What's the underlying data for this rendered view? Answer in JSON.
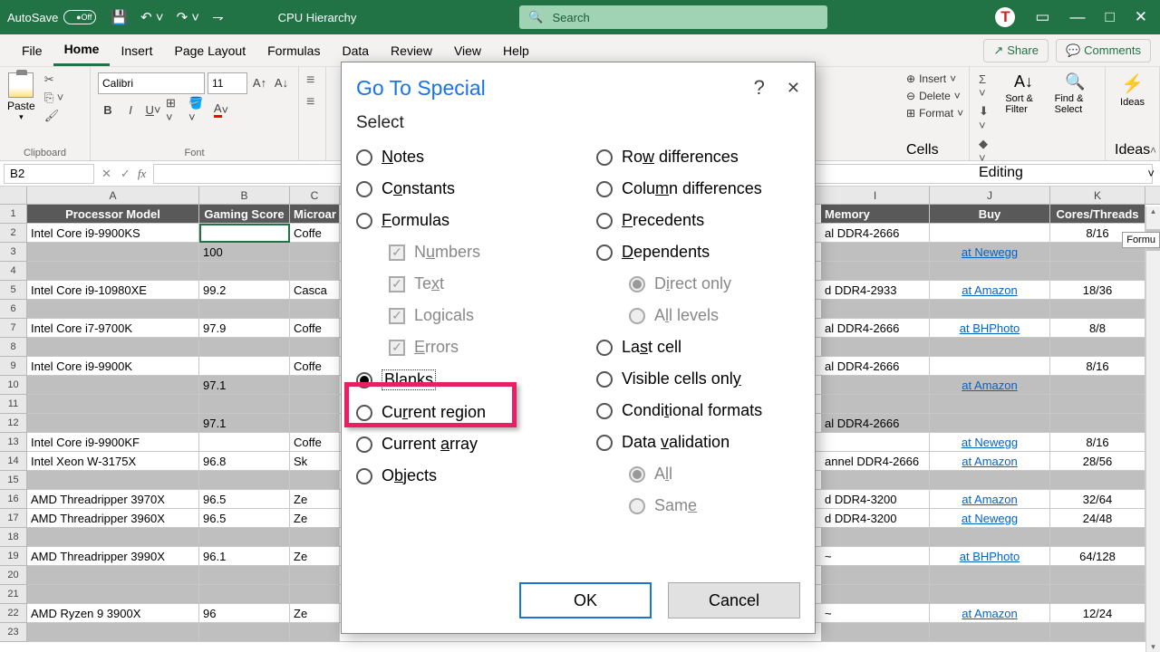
{
  "titlebar": {
    "autosave_label": "AutoSave",
    "autosave_state": "Off",
    "doc_title": "CPU Hierarchy",
    "search_placeholder": "Search",
    "avatar_initial": "T"
  },
  "tabs": {
    "items": [
      "File",
      "Home",
      "Insert",
      "Page Layout",
      "Formulas",
      "Data",
      "Review",
      "View",
      "Help"
    ],
    "active": "Home",
    "share": "Share",
    "comments": "Comments"
  },
  "ribbon": {
    "clipboard": {
      "paste": "Paste",
      "label": "Clipboard"
    },
    "font": {
      "name": "Calibri",
      "size": "11",
      "label": "Font"
    },
    "cells": {
      "insert": "Insert",
      "delete": "Delete",
      "format": "Format",
      "label": "Cells"
    },
    "editing": {
      "sort": "Sort & Filter",
      "find": "Find & Select",
      "label": "Editing"
    },
    "ideas": {
      "ideas": "Ideas",
      "label": "Ideas"
    }
  },
  "formulabar": {
    "namebox": "B2",
    "fx": "fx"
  },
  "tooltip": "Formu",
  "columns": {
    "A": "A",
    "B": "B",
    "C": "C",
    "I": "I",
    "J": "J",
    "K": "K",
    "hdr": {
      "A": "Processor Model",
      "B": "Gaming Score",
      "C": "Microar",
      "I": "Memory",
      "J": "Buy",
      "K": "Cores/Threads"
    }
  },
  "rows": [
    {
      "n": 1,
      "type": "hdr"
    },
    {
      "n": 2,
      "A": "Intel Core i9-9900KS",
      "B": "",
      "C": "Coffe",
      "I": "al DDR4-2666",
      "J": "",
      "K": "8/16",
      "active": true
    },
    {
      "n": 3,
      "A": "",
      "B": "100",
      "C": "",
      "I": "",
      "J": "at Newegg",
      "K": "",
      "blank": true
    },
    {
      "n": 4,
      "A": "",
      "B": "",
      "C": "",
      "I": "",
      "J": "",
      "K": "",
      "blank": true
    },
    {
      "n": 5,
      "A": "Intel Core i9-10980XE",
      "B": "99.2",
      "C": "Casca",
      "I": "d DDR4-2933",
      "J": "at Amazon",
      "K": "18/36"
    },
    {
      "n": 6,
      "A": "",
      "B": "",
      "C": "",
      "I": "",
      "J": "",
      "K": "",
      "blank": true
    },
    {
      "n": 7,
      "A": "Intel Core i7-9700K",
      "B": "97.9",
      "C": "Coffe",
      "I": "al DDR4-2666",
      "J": "at BHPhoto",
      "K": "8/8"
    },
    {
      "n": 8,
      "A": "",
      "B": "",
      "C": "",
      "I": "",
      "J": "",
      "K": "",
      "blank": true
    },
    {
      "n": 9,
      "A": "Intel Core i9-9900K",
      "B": "",
      "C": "Coffe",
      "I": "al DDR4-2666",
      "J": "",
      "K": "8/16"
    },
    {
      "n": 10,
      "A": "",
      "B": "97.1",
      "C": "",
      "I": "",
      "J": "at Amazon",
      "K": "",
      "blank": true
    },
    {
      "n": 11,
      "A": "",
      "B": "",
      "C": "",
      "I": "",
      "J": "",
      "K": "",
      "blank": true
    },
    {
      "n": 12,
      "A": "",
      "B": "97.1",
      "C": "",
      "I": "al DDR4-2666",
      "J": "",
      "K": "",
      "blank": true
    },
    {
      "n": 13,
      "A": "Intel Core i9-9900KF",
      "B": "",
      "C": "Coffe",
      "I": "",
      "J": "at Newegg",
      "K": "8/16"
    },
    {
      "n": 14,
      "A": "Intel Xeon W-3175X",
      "B": "96.8",
      "C": "Sk",
      "I": "annel DDR4-2666",
      "J": "at Amazon",
      "K": "28/56"
    },
    {
      "n": 15,
      "A": "",
      "B": "",
      "C": "",
      "I": "",
      "J": "",
      "K": "",
      "blank": true
    },
    {
      "n": 16,
      "A": "AMD Threadripper 3970X",
      "B": "96.5",
      "C": "Ze",
      "I": "d DDR4-3200",
      "J": "at Amazon",
      "K": "32/64"
    },
    {
      "n": 17,
      "A": "AMD Threadripper 3960X",
      "B": "96.5",
      "C": "Ze",
      "I": "d DDR4-3200",
      "J": "at Newegg",
      "K": "24/48"
    },
    {
      "n": 18,
      "A": "",
      "B": "",
      "C": "",
      "I": "",
      "J": "",
      "K": "",
      "blank": true
    },
    {
      "n": 19,
      "A": "AMD Threadripper 3990X",
      "B": "96.1",
      "C": "Ze",
      "I": "~",
      "J": "at BHPhoto",
      "K": "64/128"
    },
    {
      "n": 20,
      "A": "",
      "B": "",
      "C": "",
      "I": "",
      "J": "",
      "K": "",
      "blank": true
    },
    {
      "n": 21,
      "A": "",
      "B": "",
      "C": "",
      "I": "",
      "J": "",
      "K": "",
      "blank": true
    },
    {
      "n": 22,
      "A": "AMD Ryzen 9 3900X",
      "B": "96",
      "C": "Ze",
      "I": "~",
      "J": "at Amazon",
      "K": "12/24"
    },
    {
      "n": 23,
      "A": "",
      "B": "",
      "C": "",
      "I": "",
      "J": "",
      "K": "",
      "blank": true
    }
  ],
  "dialog": {
    "title": "Go To Special",
    "section": "Select",
    "left": [
      {
        "label": "Notes",
        "ul": "N"
      },
      {
        "label": "Constants",
        "ul": "o"
      },
      {
        "label": "Formulas",
        "ul": "F"
      },
      {
        "label": "Numbers",
        "ul": "u",
        "cb": true,
        "sub": true,
        "dis": true,
        "checked": true
      },
      {
        "label": "Text",
        "ul": "x",
        "cb": true,
        "sub": true,
        "dis": true,
        "checked": true
      },
      {
        "label": "Logicals",
        "ul": "g",
        "cb": true,
        "sub": true,
        "dis": true,
        "checked": true
      },
      {
        "label": "Errors",
        "ul": "E",
        "cb": true,
        "sub": true,
        "dis": true,
        "checked": true
      },
      {
        "label": "Blanks",
        "ul": "k",
        "sel": true,
        "special": true
      },
      {
        "label": "Current region",
        "ul": "r"
      },
      {
        "label": "Current array",
        "ul": "a"
      },
      {
        "label": "Objects",
        "ul": "b"
      }
    ],
    "right": [
      {
        "label": "Row differences",
        "ul": "w"
      },
      {
        "label": "Column differences",
        "ul": "m"
      },
      {
        "label": "Precedents",
        "ul": "P"
      },
      {
        "label": "Dependents",
        "ul": "D"
      },
      {
        "label": "Direct only",
        "ul": "i",
        "sub": true,
        "dis": true,
        "disel": true
      },
      {
        "label": "All levels",
        "ul": "l",
        "sub": true,
        "dis": true
      },
      {
        "label": "Last cell",
        "ul": "s"
      },
      {
        "label": "Visible cells only",
        "ul": "y"
      },
      {
        "label": "Conditional formats",
        "ul": "t"
      },
      {
        "label": "Data validation",
        "ul": "v"
      },
      {
        "label": "All",
        "ul": "l",
        "sub": true,
        "dis": true,
        "disel": true
      },
      {
        "label": "Same",
        "ul": "e",
        "sub": true,
        "dis": true
      }
    ],
    "ok": "OK",
    "cancel": "Cancel"
  }
}
